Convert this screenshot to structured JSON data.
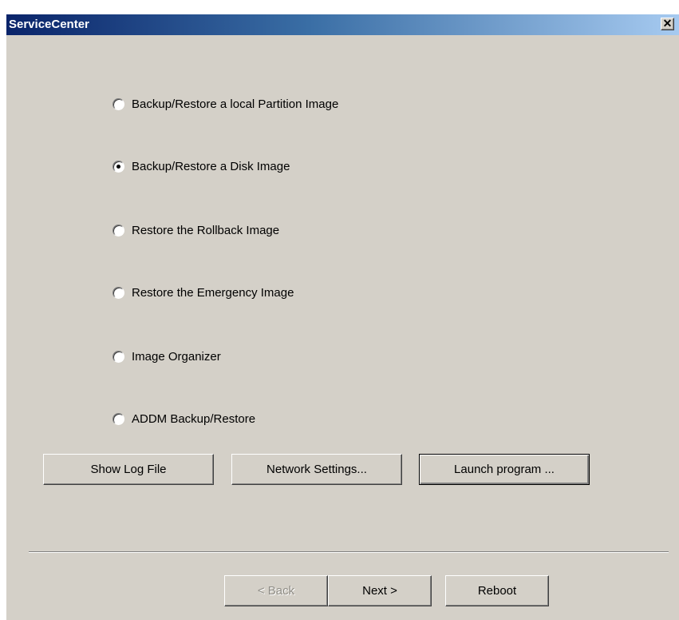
{
  "window": {
    "title": "ServiceCenter",
    "close_glyph": "✕"
  },
  "options": [
    {
      "label": "Backup/Restore a local Partition Image",
      "selected": false
    },
    {
      "label": "Backup/Restore a Disk Image",
      "selected": true
    },
    {
      "label": "Restore the Rollback Image",
      "selected": false
    },
    {
      "label": "Restore the Emergency Image",
      "selected": false
    },
    {
      "label": "Image Organizer",
      "selected": false
    },
    {
      "label": "ADDM Backup/Restore",
      "selected": false
    }
  ],
  "tools": {
    "show_log": "Show Log File",
    "network_settings": "Network Settings...",
    "launch_program": "Launch program ..."
  },
  "nav": {
    "back": "< Back",
    "back_enabled": false,
    "next": "Next >",
    "reboot": "Reboot"
  }
}
